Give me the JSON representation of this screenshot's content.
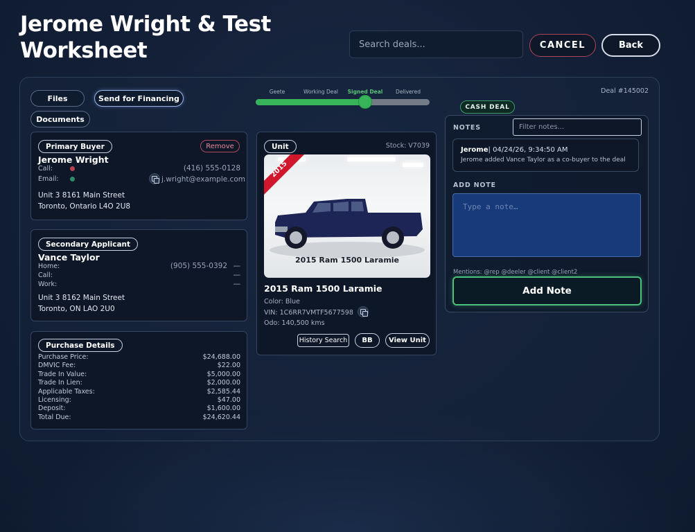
{
  "header": {
    "title": "Jerome Wright & Test Worksheet",
    "search_placeholder": "Search deals...",
    "cancel_label": "CANCEL",
    "back_label": "Back"
  },
  "actions": {
    "files": "Files",
    "send_financing": "Send for Financing",
    "documents": "Documents"
  },
  "deal": {
    "number": "Deal #145002",
    "type_badge": "CASH DEAL",
    "stages": [
      "Geete",
      "Working Deal",
      "Signed Deal",
      "Delivered"
    ],
    "active_stage": "Signed Deal",
    "progress": 0.63
  },
  "primary_buyer": {
    "tag": "Primary Buyer",
    "remove_label": "Remove",
    "name": "Jerome Wright",
    "call_label": "Call:",
    "email_label": "Email:",
    "phone": "(416) 555-0128",
    "email": "j.wright@example.com",
    "address1": "Unit 3 8161 Main Street",
    "address2": "Toronto, Ontario L4O 2U8",
    "call_status_color": "#b8424f",
    "email_status_color": "#2f8a6a"
  },
  "secondary_applicant": {
    "tag": "Secondary Applicant",
    "name": "Vance Taylor",
    "home_label": "Home:",
    "call_label": "Call:",
    "work_label": "Work:",
    "home_value": "(905) 555-0392",
    "dash": "—",
    "address1": "Unit 3 8162 Main Street",
    "address2": "Toronto, ON LAO 2U0"
  },
  "purchase": {
    "tag": "Purchase Details",
    "rows": [
      {
        "label": "Purchase Price:",
        "value": "$24,688.00"
      },
      {
        "label": "DMVIC Fee:",
        "value": "$22.00"
      },
      {
        "label": "Trade In Value:",
        "value": "$5,000.00"
      },
      {
        "label": "Trade In Lien:",
        "value": "$2,000.00"
      },
      {
        "label": "Applicable Taxes:",
        "value": "$2,585.44"
      },
      {
        "label": "Licensing:",
        "value": "$47.00"
      },
      {
        "label": "Deposit:",
        "value": "$1,600.00"
      },
      {
        "label": "Total Due:",
        "value": "$24,620.44"
      }
    ]
  },
  "unit": {
    "tag": "Unit",
    "stock": "Stock: V7039",
    "ribbon": "2015",
    "photo_caption": "2015 Ram 1500 Laramie",
    "title": "2015 Ram 1500 Laramie",
    "color": "Color: Blue",
    "vin": "VIN: 1C6RR7VMTF5677598",
    "odo": "Odo:  140,500 kms",
    "history_label": "History Search",
    "bb_label": "BB",
    "view_label": "View Unit"
  },
  "notes": {
    "label": "NOTES",
    "filter_placeholder": "Filter notes...",
    "entry": {
      "author": "Jerome",
      "timestamp": "| 04/24/26, 9:34:50 AM",
      "text": "Jerome added Vance Taylor as a co-buyer to the deal"
    },
    "add_label": "ADD NOTE",
    "textarea_placeholder": "Type a note…",
    "mentions": "Mentions: @rep @deeler @client @client2",
    "add_button": "Add Note"
  }
}
